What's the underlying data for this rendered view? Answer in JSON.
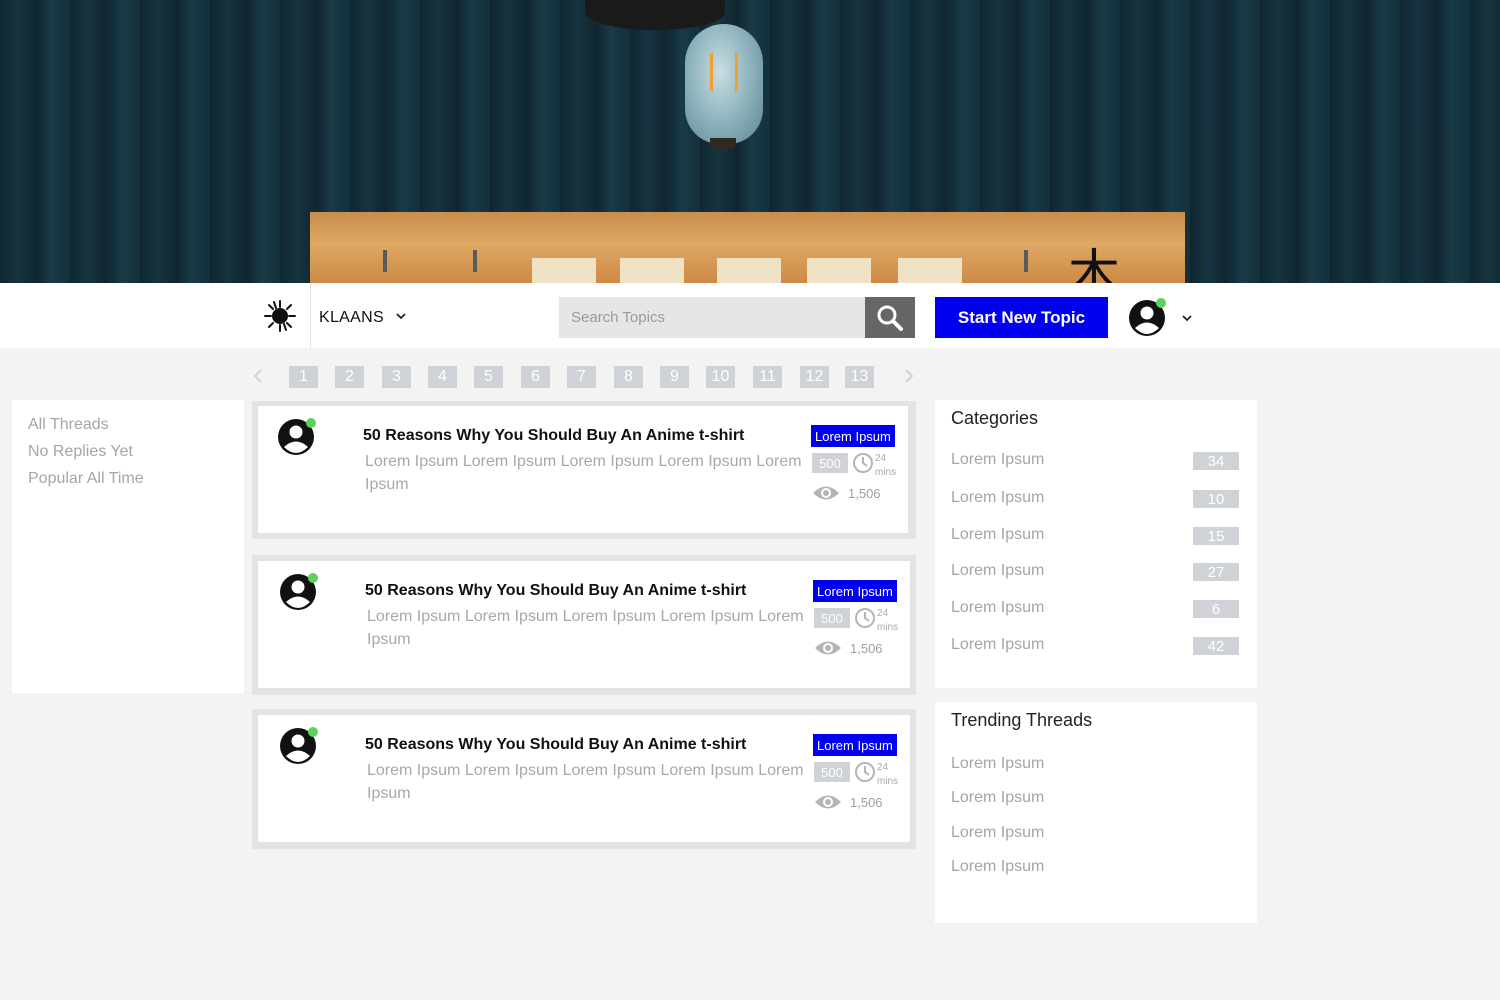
{
  "brand": {
    "name": "KLAANS"
  },
  "search": {
    "placeholder": "Search Topics"
  },
  "new_topic_label": "Start New Topic",
  "pagination": [
    "1",
    "2",
    "3",
    "4",
    "5",
    "6",
    "7",
    "8",
    "9",
    "10",
    "11",
    "12",
    "13"
  ],
  "filters": [
    "All Threads",
    "No Replies Yet",
    "Popular All Time"
  ],
  "threads": [
    {
      "title": "50 Reasons Why You Should Buy An Anime t-shirt",
      "excerpt": "Lorem Ipsum Lorem Ipsum Lorem Ipsum Lorem Ipsum Lorem Ipsum",
      "tag": "Lorem Ipsum",
      "replies": "500",
      "time_value": "24",
      "time_unit": "mins",
      "views": "1,506"
    },
    {
      "title": "50 Reasons Why You Should Buy An Anime t-shirt",
      "excerpt": "Lorem Ipsum Lorem Ipsum Lorem Ipsum Lorem Ipsum Lorem Ipsum",
      "tag": "Lorem Ipsum",
      "replies": "500",
      "time_value": "24",
      "time_unit": "mins",
      "views": "1,506"
    },
    {
      "title": "50 Reasons Why You Should Buy An Anime t-shirt",
      "excerpt": "Lorem Ipsum Lorem Ipsum Lorem Ipsum Lorem Ipsum Lorem Ipsum",
      "tag": "Lorem Ipsum",
      "replies": "500",
      "time_value": "24",
      "time_unit": "mins",
      "views": "1,506"
    }
  ],
  "categories": {
    "title": "Categories",
    "items": [
      {
        "name": "Lorem Ipsum",
        "count": "34"
      },
      {
        "name": "Lorem Ipsum",
        "count": "10"
      },
      {
        "name": "Lorem Ipsum",
        "count": "15"
      },
      {
        "name": "Lorem Ipsum",
        "count": "27"
      },
      {
        "name": "Lorem Ipsum",
        "count": "6"
      },
      {
        "name": "Lorem Ipsum",
        "count": "42"
      }
    ]
  },
  "trending": {
    "title": "Trending Threads",
    "items": [
      "Lorem Ipsum",
      "Lorem Ipsum",
      "Lorem Ipsum",
      "Lorem Ipsum"
    ]
  },
  "colors": {
    "accent": "#0000ee",
    "online": "#5bd35b",
    "badge": "#cfd2d6",
    "muted_text": "#a5a5a5"
  },
  "icons": {
    "logo": "splat-logo-icon",
    "search": "search-icon",
    "avatar": "user-avatar-icon",
    "online": "online-dot-icon",
    "clock": "clock-icon",
    "views": "eye-icon",
    "caret": "chevron-down-icon",
    "prev": "chevron-left-icon",
    "next": "chevron-right-icon"
  }
}
